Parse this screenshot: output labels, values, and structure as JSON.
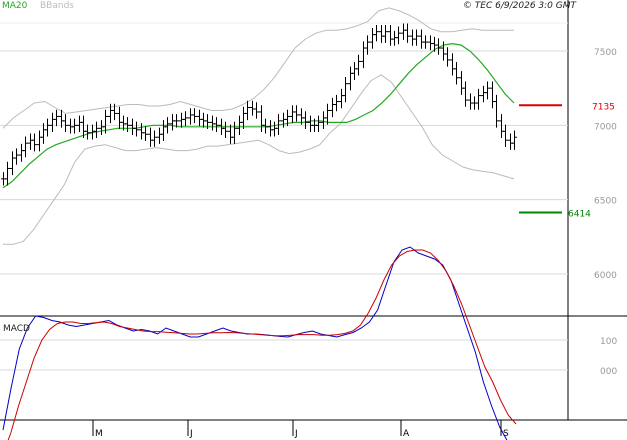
{
  "header": {
    "legend_ma20": "MA20",
    "legend_bbands": "BBands",
    "copyright": "© TEC 6/9/2026 3:0 GMT"
  },
  "colors": {
    "ma20": "#22aa22",
    "bbands": "#bbbbbb",
    "price_bar": "#000000",
    "resistance": "#dd0000",
    "support": "#008800",
    "macd_line": "#0000cc",
    "signal_line": "#cc0000"
  },
  "chart_data": [
    {
      "type": "line",
      "name": "price",
      "y_ticks": [
        "7500",
        "7000",
        "6500",
        "6000"
      ],
      "ylim": [
        5775,
        7825
      ],
      "x_labels": [
        "M",
        "J",
        "J",
        "A",
        "S"
      ],
      "levels": [
        {
          "label": "7135",
          "value": 7135,
          "kind": "resistance"
        },
        {
          "label": "6414",
          "value": 6414,
          "kind": "support"
        }
      ],
      "legend": [
        "MA20",
        "BBands"
      ],
      "grid": true,
      "bars_close": [
        6640,
        6710,
        6780,
        6800,
        6830,
        6880,
        6900,
        6870,
        6920,
        6970,
        7000,
        7040,
        7060,
        7030,
        7000,
        6990,
        7000,
        7020,
        6960,
        6950,
        6960,
        6980,
        6990,
        7060,
        7100,
        7080,
        7020,
        7010,
        7000,
        6980,
        6970,
        6950,
        6940,
        6900,
        6920,
        6940,
        6990,
        7010,
        7030,
        7030,
        7040,
        7050,
        7070,
        7060,
        7040,
        7030,
        7020,
        7010,
        7000,
        6980,
        6960,
        6920,
        6980,
        7020,
        7080,
        7120,
        7110,
        7090,
        7000,
        6990,
        6970,
        6980,
        7030,
        7040,
        7060,
        7090,
        7070,
        7050,
        7020,
        7000,
        7000,
        7020,
        7050,
        7100,
        7140,
        7160,
        7200,
        7280,
        7350,
        7380,
        7430,
        7520,
        7560,
        7610,
        7630,
        7600,
        7630,
        7580,
        7590,
        7620,
        7640,
        7600,
        7580,
        7600,
        7560,
        7560,
        7550,
        7540,
        7520,
        7480,
        7440,
        7380,
        7320,
        7250,
        7170,
        7150,
        7150,
        7200,
        7220,
        7250,
        7160,
        7030,
        6960,
        6900,
        6880,
        6920
      ],
      "ma20": [
        6580,
        6620,
        6680,
        6740,
        6790,
        6840,
        6870,
        6890,
        6910,
        6930,
        6950,
        6960,
        6970,
        6980,
        6980,
        6980,
        6990,
        7000,
        7000,
        7000,
        6990,
        6990,
        6990,
        6990,
        6990,
        6990,
        6990,
        6990,
        6990,
        6990,
        6990,
        7000,
        7010,
        7020,
        7020,
        7030,
        7030,
        7020,
        7020,
        7020,
        7040,
        7070,
        7100,
        7150,
        7210,
        7280,
        7350,
        7410,
        7460,
        7510,
        7540,
        7550,
        7540,
        7500,
        7440,
        7370,
        7290,
        7210,
        7150
      ],
      "bb_upper": [
        6980,
        7050,
        7100,
        7150,
        7160,
        7120,
        7080,
        7090,
        7100,
        7110,
        7120,
        7130,
        7140,
        7140,
        7130,
        7130,
        7140,
        7160,
        7140,
        7120,
        7100,
        7100,
        7110,
        7140,
        7180,
        7240,
        7320,
        7420,
        7520,
        7580,
        7620,
        7640,
        7640,
        7650,
        7670,
        7700,
        7770,
        7790,
        7770,
        7740,
        7700,
        7650,
        7630,
        7630,
        7640,
        7650,
        7640,
        7640,
        7640,
        7640
      ],
      "bb_lower": [
        6200,
        6200,
        6220,
        6300,
        6400,
        6500,
        6600,
        6750,
        6840,
        6860,
        6870,
        6850,
        6830,
        6830,
        6840,
        6850,
        6840,
        6830,
        6830,
        6840,
        6860,
        6860,
        6870,
        6880,
        6890,
        6900,
        6870,
        6830,
        6810,
        6820,
        6840,
        6870,
        6950,
        7010,
        7110,
        7210,
        7300,
        7340,
        7290,
        7190,
        7090,
        6990,
        6870,
        6800,
        6760,
        6720,
        6700,
        6690,
        6680,
        6660,
        6640
      ],
      "bb_lower_end": 6680
    },
    {
      "type": "line",
      "name": "MACD",
      "title": "MACD",
      "y_ticks": [
        "100",
        "000"
      ],
      "series": [
        {
          "name": "MACD",
          "values": [
            -200,
            -60,
            70,
            140,
            180,
            175,
            165,
            160,
            150,
            145,
            150,
            155,
            160,
            165,
            150,
            140,
            130,
            135,
            130,
            120,
            140,
            130,
            120,
            110,
            110,
            120,
            130,
            140,
            130,
            125,
            120,
            120,
            118,
            115,
            112,
            110,
            118,
            125,
            130,
            120,
            115,
            110,
            118,
            125,
            140,
            160,
            200,
            280,
            360,
            400,
            410,
            390,
            380,
            370,
            350,
            300,
            220,
            140,
            60,
            -40,
            -120,
            -190,
            -240,
            -250
          ]
        },
        {
          "name": "Signal",
          "values": [
            -280,
            -210,
            -120,
            -40,
            40,
            100,
            135,
            155,
            160,
            160,
            155,
            155,
            158,
            160,
            155,
            145,
            140,
            135,
            130,
            128,
            128,
            126,
            124,
            122,
            120,
            120,
            122,
            124,
            124,
            125,
            124,
            122,
            120,
            118,
            116,
            114,
            114,
            116,
            118,
            118,
            118,
            116,
            116,
            118,
            122,
            130,
            150,
            190,
            240,
            300,
            350,
            380,
            395,
            400,
            400,
            390,
            365,
            330,
            280,
            220,
            150,
            80,
            10,
            -40,
            -100,
            -150,
            -180
          ]
        }
      ]
    }
  ]
}
